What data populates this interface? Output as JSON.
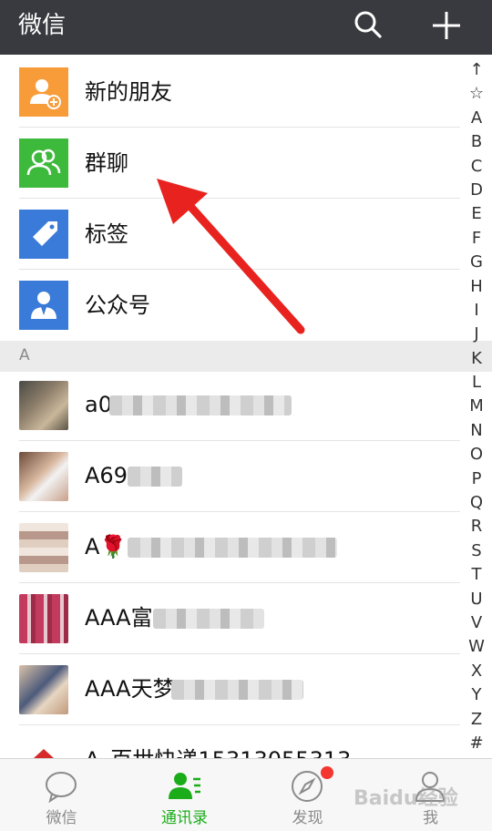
{
  "header": {
    "title": "微信"
  },
  "entries": [
    {
      "label": "新的朋友",
      "color": "#f89c3a",
      "icon": "add-friend-icon"
    },
    {
      "label": "群聊",
      "color": "#3db93b",
      "icon": "group-chat-icon"
    },
    {
      "label": "标签",
      "color": "#3a7ad8",
      "icon": "tag-icon"
    },
    {
      "label": "公众号",
      "color": "#3a7ad8",
      "icon": "official-account-icon"
    }
  ],
  "section": {
    "letter": "A"
  },
  "contacts": [
    {
      "name": "a0"
    },
    {
      "name": "A69"
    },
    {
      "name": "A🌹"
    },
    {
      "name": "AAA富"
    },
    {
      "name": "AAA天梦"
    },
    {
      "name": "A_百世快递15313055313"
    }
  ],
  "index_letters": [
    "↑",
    "☆",
    "A",
    "B",
    "C",
    "D",
    "E",
    "F",
    "G",
    "H",
    "I",
    "J",
    "K",
    "L",
    "M",
    "N",
    "O",
    "P",
    "Q",
    "R",
    "S",
    "T",
    "U",
    "V",
    "W",
    "X",
    "Y",
    "Z",
    "#"
  ],
  "tabs": [
    {
      "label": "微信",
      "icon": "chat-bubble-icon"
    },
    {
      "label": "通讯录",
      "icon": "contacts-icon",
      "active": true
    },
    {
      "label": "发现",
      "icon": "compass-icon",
      "badge": true
    },
    {
      "label": "我",
      "icon": "person-icon"
    }
  ],
  "watermark": "Baidu经验",
  "colors": {
    "header_bg": "#393a3f",
    "accent_green": "#1aad19",
    "arrow_red": "#e8231f",
    "badge_red": "#f43530"
  }
}
